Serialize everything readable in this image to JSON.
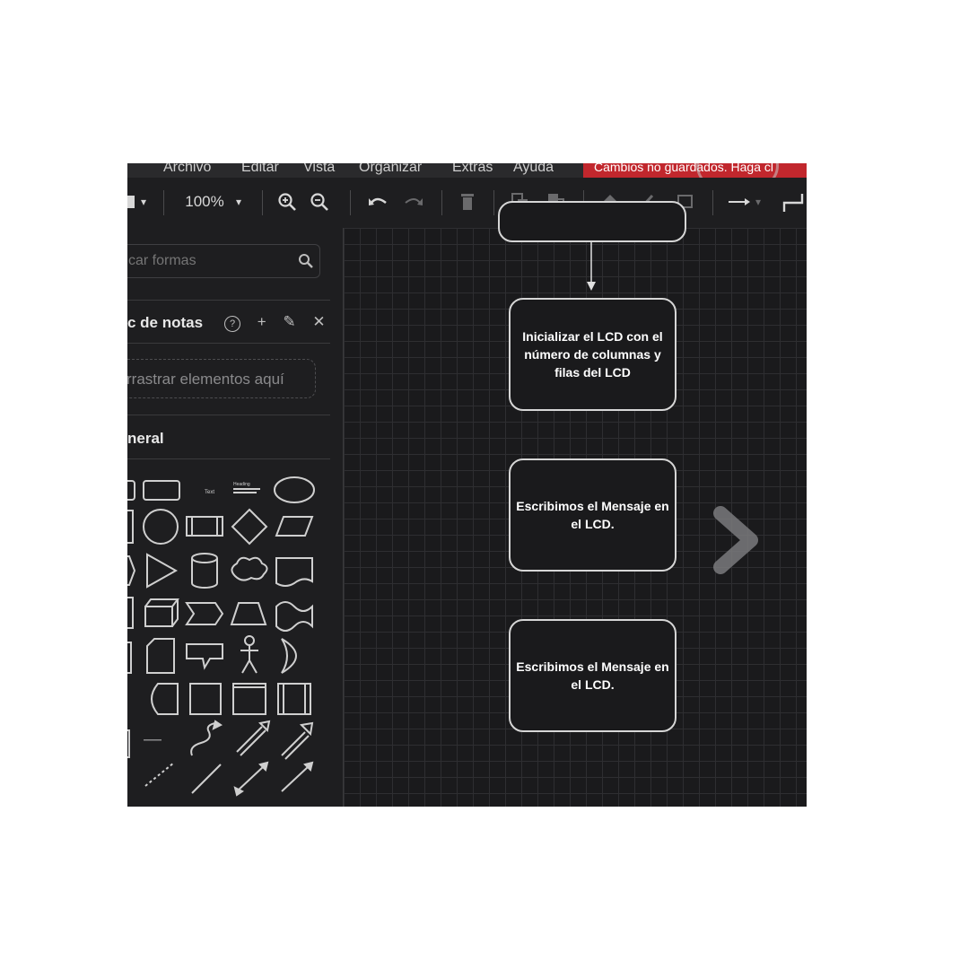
{
  "menubar": {
    "items": [
      "Archivo",
      "Editar",
      "Vista",
      "Organizar",
      "Extras",
      "Ayuda"
    ],
    "unsaved_notice": "Cambios no guardados. Haga cl"
  },
  "toolbar": {
    "zoom": "100%",
    "caret": "▾",
    "icons": [
      "page-menu-icon",
      "zoom-in-icon",
      "zoom-out-icon",
      "undo-icon",
      "redo-icon",
      "delete-icon",
      "to-front-icon",
      "to-back-icon",
      "fill-color-icon",
      "line-color-icon",
      "shadow-icon",
      "connection-icon",
      "waypoints-icon"
    ]
  },
  "sidebar": {
    "search_placeholder": "car formas",
    "notes_title": "c de notas",
    "notes_actions": {
      "help": "?",
      "add": "+",
      "edit": "✎",
      "close": "✕"
    },
    "drop_hint": "rrastrar elementos aquí",
    "general_title": "neral",
    "shape_text_label": "Text",
    "shape_textbox_label": "Heading"
  },
  "canvas": {
    "nodes": [
      {
        "id": "node-top",
        "text": ""
      },
      {
        "id": "node-init-lcd",
        "text": "Inicializar el LCD con el número de  columnas y filas del LCD"
      },
      {
        "id": "node-msg-1",
        "text": "Escribimos el Mensaje en el LCD."
      },
      {
        "id": "node-msg-2",
        "text": "Escribimos el Mensaje en el LCD."
      }
    ]
  },
  "colors": {
    "background": "#1b1b1d",
    "canvas": "#1a1a1c",
    "grid": "#2e2e31",
    "node_border": "#d6d6d6",
    "unsaved_red": "#c1272d",
    "text": "#ffffff"
  }
}
